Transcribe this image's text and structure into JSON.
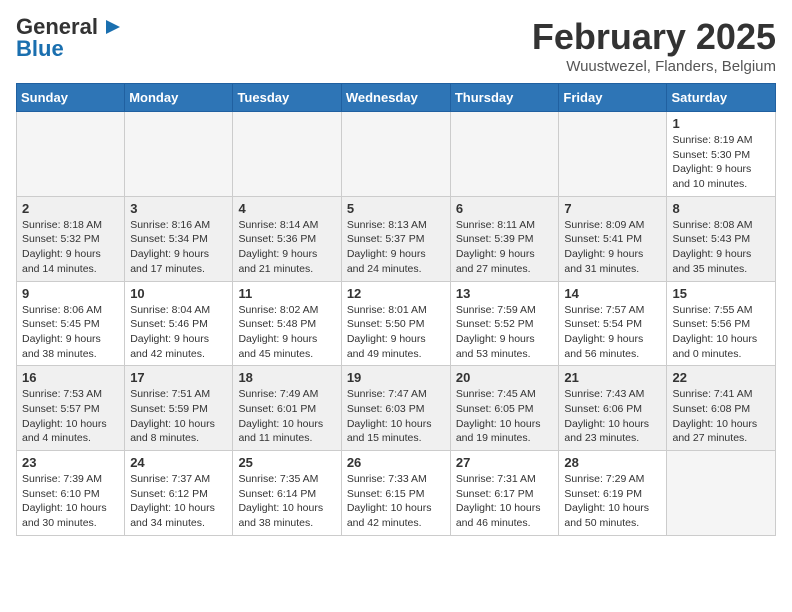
{
  "header": {
    "logo_general": "General",
    "logo_blue": "Blue",
    "title": "February 2025",
    "subtitle": "Wuustwezel, Flanders, Belgium"
  },
  "weekdays": [
    "Sunday",
    "Monday",
    "Tuesday",
    "Wednesday",
    "Thursday",
    "Friday",
    "Saturday"
  ],
  "weeks": [
    [
      {
        "num": "",
        "info": "",
        "empty": true
      },
      {
        "num": "",
        "info": "",
        "empty": true
      },
      {
        "num": "",
        "info": "",
        "empty": true
      },
      {
        "num": "",
        "info": "",
        "empty": true
      },
      {
        "num": "",
        "info": "",
        "empty": true
      },
      {
        "num": "",
        "info": "",
        "empty": true
      },
      {
        "num": "1",
        "info": "Sunrise: 8:19 AM\nSunset: 5:30 PM\nDaylight: 9 hours and 10 minutes.",
        "empty": false
      }
    ],
    [
      {
        "num": "2",
        "info": "Sunrise: 8:18 AM\nSunset: 5:32 PM\nDaylight: 9 hours and 14 minutes.",
        "empty": false
      },
      {
        "num": "3",
        "info": "Sunrise: 8:16 AM\nSunset: 5:34 PM\nDaylight: 9 hours and 17 minutes.",
        "empty": false
      },
      {
        "num": "4",
        "info": "Sunrise: 8:14 AM\nSunset: 5:36 PM\nDaylight: 9 hours and 21 minutes.",
        "empty": false
      },
      {
        "num": "5",
        "info": "Sunrise: 8:13 AM\nSunset: 5:37 PM\nDaylight: 9 hours and 24 minutes.",
        "empty": false
      },
      {
        "num": "6",
        "info": "Sunrise: 8:11 AM\nSunset: 5:39 PM\nDaylight: 9 hours and 27 minutes.",
        "empty": false
      },
      {
        "num": "7",
        "info": "Sunrise: 8:09 AM\nSunset: 5:41 PM\nDaylight: 9 hours and 31 minutes.",
        "empty": false
      },
      {
        "num": "8",
        "info": "Sunrise: 8:08 AM\nSunset: 5:43 PM\nDaylight: 9 hours and 35 minutes.",
        "empty": false
      }
    ],
    [
      {
        "num": "9",
        "info": "Sunrise: 8:06 AM\nSunset: 5:45 PM\nDaylight: 9 hours and 38 minutes.",
        "empty": false
      },
      {
        "num": "10",
        "info": "Sunrise: 8:04 AM\nSunset: 5:46 PM\nDaylight: 9 hours and 42 minutes.",
        "empty": false
      },
      {
        "num": "11",
        "info": "Sunrise: 8:02 AM\nSunset: 5:48 PM\nDaylight: 9 hours and 45 minutes.",
        "empty": false
      },
      {
        "num": "12",
        "info": "Sunrise: 8:01 AM\nSunset: 5:50 PM\nDaylight: 9 hours and 49 minutes.",
        "empty": false
      },
      {
        "num": "13",
        "info": "Sunrise: 7:59 AM\nSunset: 5:52 PM\nDaylight: 9 hours and 53 minutes.",
        "empty": false
      },
      {
        "num": "14",
        "info": "Sunrise: 7:57 AM\nSunset: 5:54 PM\nDaylight: 9 hours and 56 minutes.",
        "empty": false
      },
      {
        "num": "15",
        "info": "Sunrise: 7:55 AM\nSunset: 5:56 PM\nDaylight: 10 hours and 0 minutes.",
        "empty": false
      }
    ],
    [
      {
        "num": "16",
        "info": "Sunrise: 7:53 AM\nSunset: 5:57 PM\nDaylight: 10 hours and 4 minutes.",
        "empty": false
      },
      {
        "num": "17",
        "info": "Sunrise: 7:51 AM\nSunset: 5:59 PM\nDaylight: 10 hours and 8 minutes.",
        "empty": false
      },
      {
        "num": "18",
        "info": "Sunrise: 7:49 AM\nSunset: 6:01 PM\nDaylight: 10 hours and 11 minutes.",
        "empty": false
      },
      {
        "num": "19",
        "info": "Sunrise: 7:47 AM\nSunset: 6:03 PM\nDaylight: 10 hours and 15 minutes.",
        "empty": false
      },
      {
        "num": "20",
        "info": "Sunrise: 7:45 AM\nSunset: 6:05 PM\nDaylight: 10 hours and 19 minutes.",
        "empty": false
      },
      {
        "num": "21",
        "info": "Sunrise: 7:43 AM\nSunset: 6:06 PM\nDaylight: 10 hours and 23 minutes.",
        "empty": false
      },
      {
        "num": "22",
        "info": "Sunrise: 7:41 AM\nSunset: 6:08 PM\nDaylight: 10 hours and 27 minutes.",
        "empty": false
      }
    ],
    [
      {
        "num": "23",
        "info": "Sunrise: 7:39 AM\nSunset: 6:10 PM\nDaylight: 10 hours and 30 minutes.",
        "empty": false
      },
      {
        "num": "24",
        "info": "Sunrise: 7:37 AM\nSunset: 6:12 PM\nDaylight: 10 hours and 34 minutes.",
        "empty": false
      },
      {
        "num": "25",
        "info": "Sunrise: 7:35 AM\nSunset: 6:14 PM\nDaylight: 10 hours and 38 minutes.",
        "empty": false
      },
      {
        "num": "26",
        "info": "Sunrise: 7:33 AM\nSunset: 6:15 PM\nDaylight: 10 hours and 42 minutes.",
        "empty": false
      },
      {
        "num": "27",
        "info": "Sunrise: 7:31 AM\nSunset: 6:17 PM\nDaylight: 10 hours and 46 minutes.",
        "empty": false
      },
      {
        "num": "28",
        "info": "Sunrise: 7:29 AM\nSunset: 6:19 PM\nDaylight: 10 hours and 50 minutes.",
        "empty": false
      },
      {
        "num": "",
        "info": "",
        "empty": true
      }
    ]
  ]
}
